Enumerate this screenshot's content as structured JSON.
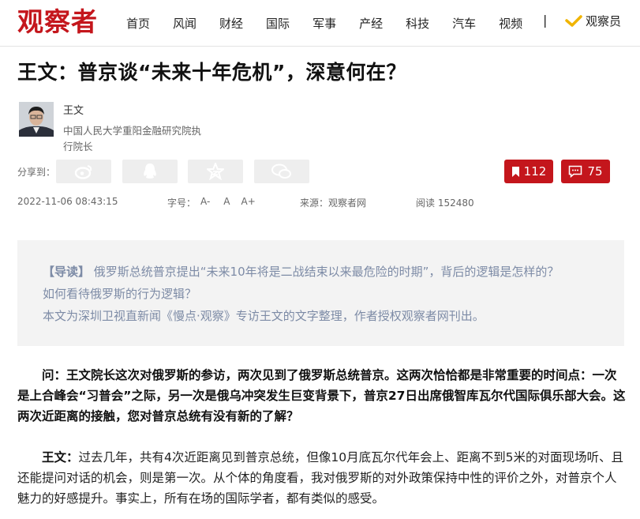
{
  "site": {
    "logo": "观察者"
  },
  "nav": {
    "items": [
      "首页",
      "风闻",
      "财经",
      "国际",
      "军事",
      "产经",
      "科技",
      "汽车",
      "视频"
    ],
    "separator": "|",
    "member_label": "观察员"
  },
  "article": {
    "title": "王文：普京谈“未来十年危机”，深意何在？",
    "author": {
      "name": "王文",
      "desc": "中国人民大学重阳金融研究院执行院长"
    },
    "share_label": "分享到：",
    "bookmark_count": "112",
    "comment_count": "75",
    "datetime": "2022-11-06 08:43:15",
    "fontsize_label": "字号：",
    "fontsize_options": [
      "A-",
      "A",
      "A+"
    ],
    "source": "来源：观察者网",
    "reads": "阅读 152480"
  },
  "intro": {
    "lead": "【导读】",
    "text1": " 俄罗斯总统普京提出“未来10年将是二战结束以来最危险的时期”，背后的逻辑是怎样的？",
    "text2": "如何看待俄罗斯的行为逻辑？",
    "text3": "本文为深圳卫视直新闻《慢点·观察》专访王文的文字整理，作者授权观察者网刊出。"
  },
  "body": {
    "question": "问：王文院长这次对俄罗斯的参访，两次见到了俄罗斯总统普京。这两次恰恰都是非常重要的时间点：一次是上合峰会“习普会”之际，另一次是俄乌冲突发生巨变背景下，普京27日出席俄智库瓦尔代国际俱乐部大会。这两次近距离的接触，您对普京总统有没有新的了解？",
    "answer_speaker": "王文：",
    "answer": "过去几年，共有4次近距离见到普京总统，但像10月底瓦尔代年会上、距离不到5米的对面现场听、且还能提问对话的机会，则是第一次。从个体的角度看，我对俄罗斯的对外政策保持中性的评价之外，对普京个人魅力的好感提升。事实上，所有在场的国际学者，都有类似的感受。"
  },
  "colors": {
    "brand": "#c4161c",
    "intro_text": "#7d8ba6",
    "intro_bg": "#f3f3f3"
  }
}
